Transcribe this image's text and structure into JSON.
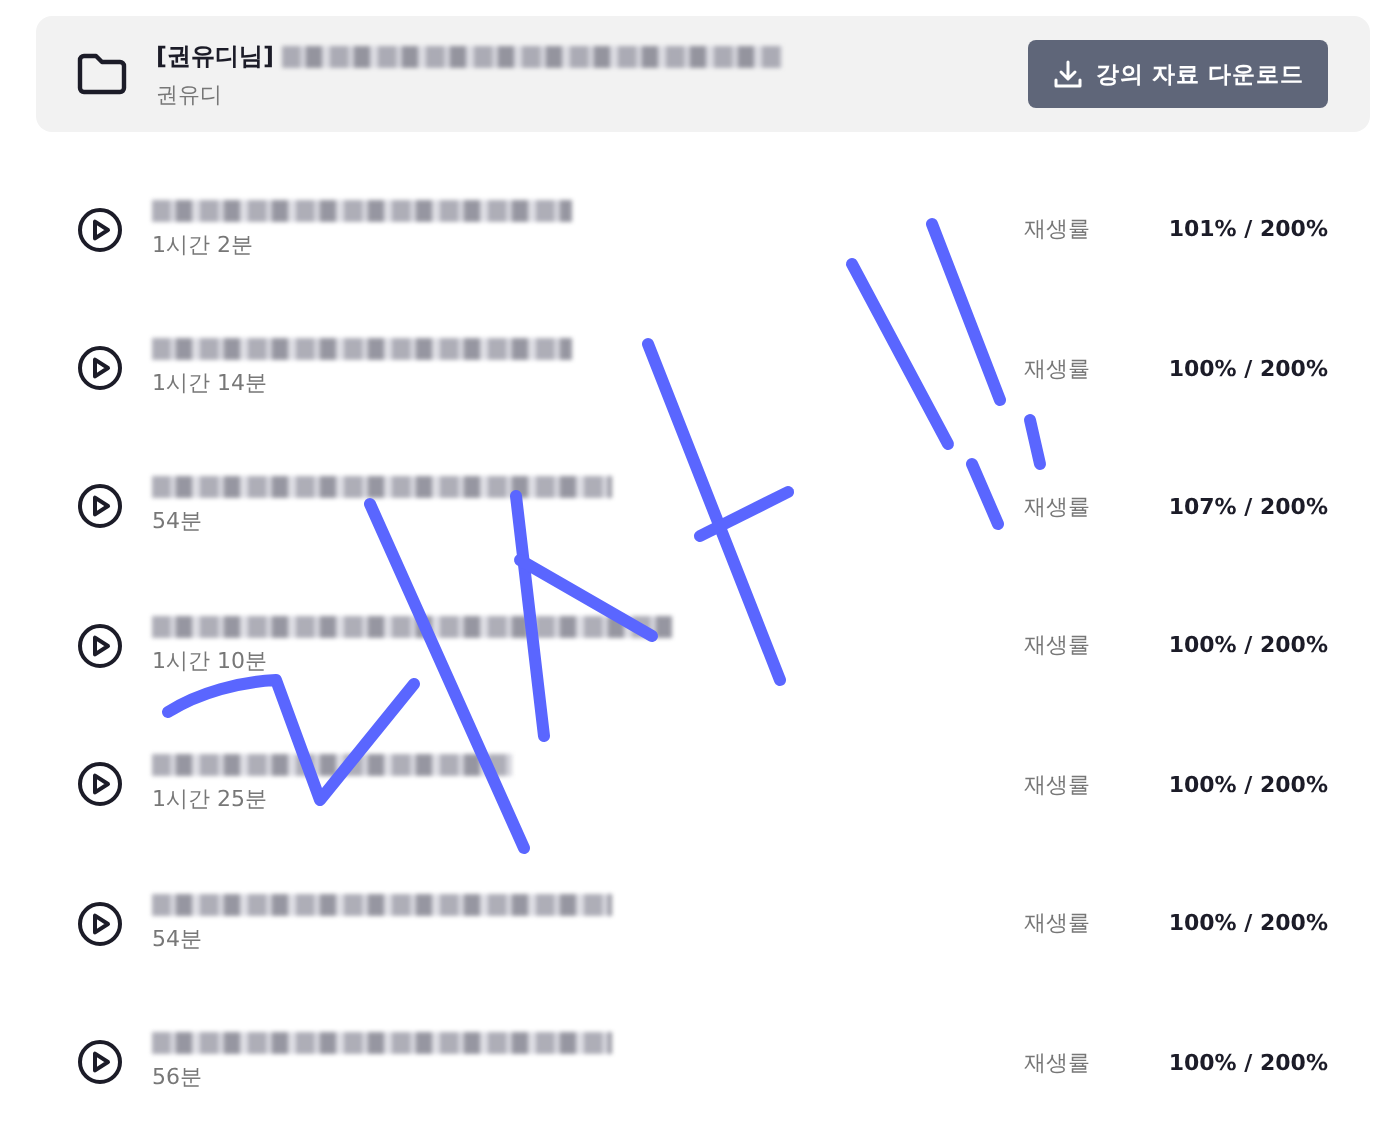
{
  "course": {
    "title_prefix": "[권유디님]",
    "instructor": "권유디",
    "download_button": "강의 자료 다운로드"
  },
  "lessons": [
    {
      "duration": "1시간 2분",
      "rate_label": "재생률",
      "rate": "101% / 200%"
    },
    {
      "duration": "1시간 14분",
      "rate_label": "재생률",
      "rate": "100% / 200%"
    },
    {
      "duration": "54분",
      "rate_label": "재생률",
      "rate": "107% / 200%"
    },
    {
      "duration": "1시간 10분",
      "rate_label": "재생률",
      "rate": "100% / 200%"
    },
    {
      "duration": "1시간 25분",
      "rate_label": "재생률",
      "rate": "100% / 200%"
    },
    {
      "duration": "54분",
      "rate_label": "재생률",
      "rate": "100% / 200%"
    },
    {
      "duration": "56분",
      "rate_label": "재생률",
      "rate": "100% / 200%"
    }
  ]
}
